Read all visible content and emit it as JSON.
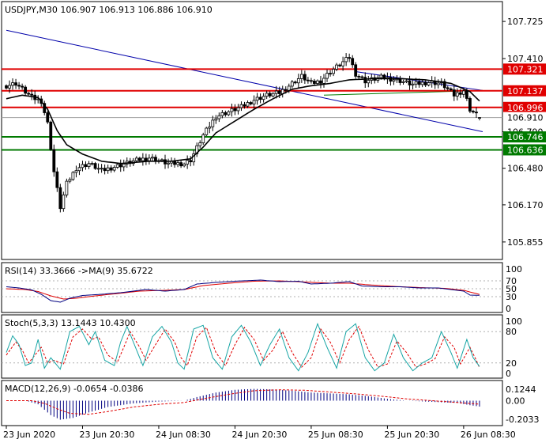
{
  "window": {
    "title": "USDJPY,M30  106.907 106.913 106.886 106.910"
  },
  "colors": {
    "background": "#ffffff",
    "frame": "#000000",
    "candle": "#000000",
    "ma_line": "#000000",
    "support_line": "#007a00",
    "resistance_line": "#e00000",
    "trendline": "#0000aa",
    "current_price_line": "#a0a0a0",
    "rsi_line": "#000080",
    "rsi_ma_line": "#e00000",
    "stoch_main": "#17a5a5",
    "stoch_signal": "#e00000",
    "macd_hist": "#000080",
    "macd_signal": "#e00000",
    "level_grid": "#b0b0b0"
  },
  "chart_data": [
    {
      "type": "candlestick",
      "name": "price",
      "symbol": "USDJPY",
      "timeframe": "M30",
      "header": "USDJPY,M30  106.907 106.913 106.886 106.910",
      "ohlc_current": {
        "open": 106.907,
        "high": 106.913,
        "low": 106.886,
        "close": 106.91
      },
      "ylim": [
        105.72,
        107.88
      ],
      "y_ticks": [
        107.725,
        107.41,
        107.1,
        106.79,
        106.48,
        106.17,
        105.855
      ],
      "y_tick_labels": [
        "107.725",
        "107.410",
        "",
        "106.790",
        "106.480",
        "106.170",
        "105.855"
      ],
      "x_tick_labels": [
        "23 Jun 2020",
        "23 Jun 20:30",
        "24 Jun 08:30",
        "24 Jun 20:30",
        "25 Jun 08:30",
        "25 Jun 20:30",
        "26 Jun 08:30"
      ],
      "x_tick_bars": [
        0,
        24,
        48,
        72,
        96,
        120,
        144
      ],
      "bars": 150,
      "anchors": [
        [
          0,
          107.18
        ],
        [
          3,
          107.2
        ],
        [
          8,
          107.08
        ],
        [
          11,
          107.05
        ],
        [
          13,
          106.86
        ],
        [
          15,
          106.45
        ],
        [
          17,
          106.15
        ],
        [
          19,
          106.35
        ],
        [
          22,
          106.48
        ],
        [
          26,
          106.52
        ],
        [
          30,
          106.46
        ],
        [
          35,
          106.5
        ],
        [
          40,
          106.54
        ],
        [
          45,
          106.57
        ],
        [
          51,
          106.52
        ],
        [
          56,
          106.52
        ],
        [
          58,
          106.55
        ],
        [
          62,
          106.76
        ],
        [
          66,
          106.92
        ],
        [
          70,
          106.96
        ],
        [
          74,
          107.0
        ],
        [
          78,
          107.06
        ],
        [
          82,
          107.1
        ],
        [
          86,
          107.12
        ],
        [
          90,
          107.2
        ],
        [
          93,
          107.26
        ],
        [
          96,
          107.2
        ],
        [
          99,
          107.22
        ],
        [
          102,
          107.3
        ],
        [
          105,
          107.36
        ],
        [
          108,
          107.42
        ],
        [
          110,
          107.28
        ],
        [
          113,
          107.22
        ],
        [
          118,
          107.25
        ],
        [
          123,
          107.23
        ],
        [
          128,
          107.19
        ],
        [
          133,
          107.21
        ],
        [
          137,
          107.2
        ],
        [
          141,
          107.1
        ],
        [
          144,
          107.14
        ],
        [
          146,
          106.98
        ],
        [
          149,
          106.91
        ]
      ],
      "moving_average": {
        "anchors": [
          [
            0,
            107.07
          ],
          [
            5,
            107.1
          ],
          [
            10,
            107.08
          ],
          [
            13,
            106.98
          ],
          [
            16,
            106.8
          ],
          [
            19,
            106.68
          ],
          [
            24,
            106.6
          ],
          [
            30,
            106.54
          ],
          [
            36,
            106.52
          ],
          [
            45,
            106.54
          ],
          [
            52,
            106.54
          ],
          [
            58,
            106.56
          ],
          [
            62,
            106.66
          ],
          [
            66,
            106.78
          ],
          [
            72,
            106.88
          ],
          [
            78,
            106.98
          ],
          [
            84,
            107.07
          ],
          [
            90,
            107.15
          ],
          [
            96,
            107.18
          ],
          [
            102,
            107.2
          ],
          [
            108,
            107.23
          ],
          [
            116,
            107.24
          ],
          [
            124,
            107.24
          ],
          [
            132,
            107.23
          ],
          [
            140,
            107.2
          ],
          [
            146,
            107.13
          ],
          [
            149,
            107.05
          ]
        ]
      },
      "horizontal_levels": [
        {
          "value": 107.321,
          "label": "107.321",
          "kind": "resistance",
          "color": "#e00000"
        },
        {
          "value": 107.137,
          "label": "107.137",
          "kind": "resistance",
          "color": "#e00000"
        },
        {
          "value": 106.996,
          "label": "106.996",
          "kind": "resistance",
          "color": "#e00000"
        },
        {
          "value": 106.746,
          "label": "106.746",
          "kind": "support",
          "color": "#007a00"
        },
        {
          "value": 106.636,
          "label": "106.636",
          "kind": "support",
          "color": "#007a00"
        }
      ],
      "current_price": {
        "value": 106.91,
        "label": "106.910"
      },
      "trendlines": [
        {
          "from": [
            0,
            107.65
          ],
          "to": [
            150,
            106.79
          ],
          "color": "#0000aa"
        },
        {
          "from": [
            110,
            107.3
          ],
          "to": [
            150,
            107.14
          ],
          "color": "#0000aa"
        },
        {
          "from": [
            100,
            107.1
          ],
          "to": [
            150,
            107.14
          ],
          "color": "#007a00"
        }
      ]
    },
    {
      "type": "line",
      "name": "rsi",
      "header": "RSI(14) 33.3666 ->MA(9) 35.6722",
      "rsi_value": 33.3666,
      "ma_value": 35.6722,
      "ylim": [
        0,
        100
      ],
      "levels": [
        100,
        70,
        50,
        30,
        0
      ],
      "level_labels": [
        "100",
        "70",
        "50",
        "30",
        "0"
      ],
      "rsi_anchors": [
        [
          0,
          55
        ],
        [
          4,
          52
        ],
        [
          8,
          47
        ],
        [
          11,
          36
        ],
        [
          14,
          20
        ],
        [
          17,
          16
        ],
        [
          20,
          26
        ],
        [
          24,
          33
        ],
        [
          30,
          36
        ],
        [
          36,
          40
        ],
        [
          44,
          48
        ],
        [
          50,
          44
        ],
        [
          56,
          48
        ],
        [
          60,
          62
        ],
        [
          66,
          66
        ],
        [
          72,
          69
        ],
        [
          80,
          72
        ],
        [
          86,
          68
        ],
        [
          92,
          69
        ],
        [
          96,
          62
        ],
        [
          102,
          64
        ],
        [
          108,
          68
        ],
        [
          112,
          57
        ],
        [
          118,
          55
        ],
        [
          124,
          55
        ],
        [
          130,
          52
        ],
        [
          136,
          52
        ],
        [
          140,
          48
        ],
        [
          144,
          44
        ],
        [
          146,
          34
        ],
        [
          149,
          33.37
        ]
      ],
      "ma_anchors": [
        [
          0,
          50
        ],
        [
          6,
          48
        ],
        [
          10,
          43
        ],
        [
          14,
          32
        ],
        [
          18,
          24
        ],
        [
          22,
          26
        ],
        [
          28,
          32
        ],
        [
          34,
          37
        ],
        [
          42,
          44
        ],
        [
          50,
          46
        ],
        [
          56,
          48
        ],
        [
          62,
          58
        ],
        [
          70,
          64
        ],
        [
          78,
          69
        ],
        [
          86,
          70
        ],
        [
          94,
          67
        ],
        [
          102,
          64
        ],
        [
          108,
          64
        ],
        [
          114,
          60
        ],
        [
          122,
          56
        ],
        [
          130,
          53
        ],
        [
          138,
          51
        ],
        [
          144,
          46
        ],
        [
          149,
          35.67
        ]
      ]
    },
    {
      "type": "line",
      "name": "stochastic",
      "header": "Stoch(5,3,3) 13.1443 10.4300",
      "main_value": 13.1443,
      "signal_value": 10.43,
      "ylim": [
        0,
        100
      ],
      "levels": [
        100,
        80,
        20,
        0
      ],
      "level_labels": [
        "100",
        "80",
        "20",
        "0"
      ],
      "main_anchors": [
        [
          0,
          40
        ],
        [
          2,
          72
        ],
        [
          4,
          55
        ],
        [
          6,
          15
        ],
        [
          8,
          20
        ],
        [
          10,
          65
        ],
        [
          12,
          10
        ],
        [
          14,
          30
        ],
        [
          17,
          8
        ],
        [
          20,
          80
        ],
        [
          23,
          90
        ],
        [
          26,
          55
        ],
        [
          28,
          80
        ],
        [
          31,
          25
        ],
        [
          34,
          15
        ],
        [
          36,
          60
        ],
        [
          38,
          90
        ],
        [
          41,
          45
        ],
        [
          43,
          15
        ],
        [
          46,
          70
        ],
        [
          49,
          90
        ],
        [
          52,
          60
        ],
        [
          54,
          20
        ],
        [
          56,
          8
        ],
        [
          59,
          85
        ],
        [
          62,
          92
        ],
        [
          65,
          30
        ],
        [
          68,
          8
        ],
        [
          71,
          70
        ],
        [
          74,
          92
        ],
        [
          77,
          60
        ],
        [
          80,
          15
        ],
        [
          83,
          55
        ],
        [
          86,
          85
        ],
        [
          89,
          30
        ],
        [
          92,
          5
        ],
        [
          95,
          40
        ],
        [
          98,
          95
        ],
        [
          101,
          50
        ],
        [
          104,
          10
        ],
        [
          107,
          80
        ],
        [
          110,
          95
        ],
        [
          113,
          30
        ],
        [
          116,
          5
        ],
        [
          119,
          20
        ],
        [
          122,
          75
        ],
        [
          125,
          30
        ],
        [
          128,
          5
        ],
        [
          131,
          20
        ],
        [
          134,
          30
        ],
        [
          137,
          80
        ],
        [
          140,
          40
        ],
        [
          142,
          10
        ],
        [
          145,
          65
        ],
        [
          147,
          30
        ],
        [
          149,
          13.14
        ]
      ],
      "signal_anchors": [
        [
          0,
          35
        ],
        [
          3,
          60
        ],
        [
          5,
          45
        ],
        [
          7,
          20
        ],
        [
          9,
          35
        ],
        [
          11,
          50
        ],
        [
          13,
          20
        ],
        [
          15,
          25
        ],
        [
          18,
          18
        ],
        [
          21,
          70
        ],
        [
          24,
          85
        ],
        [
          27,
          65
        ],
        [
          29,
          70
        ],
        [
          32,
          35
        ],
        [
          35,
          22
        ],
        [
          37,
          50
        ],
        [
          39,
          80
        ],
        [
          42,
          50
        ],
        [
          44,
          25
        ],
        [
          47,
          55
        ],
        [
          50,
          85
        ],
        [
          53,
          60
        ],
        [
          55,
          30
        ],
        [
          57,
          15
        ],
        [
          60,
          70
        ],
        [
          63,
          88
        ],
        [
          66,
          40
        ],
        [
          69,
          15
        ],
        [
          72,
          55
        ],
        [
          75,
          88
        ],
        [
          78,
          65
        ],
        [
          81,
          25
        ],
        [
          84,
          45
        ],
        [
          87,
          80
        ],
        [
          90,
          40
        ],
        [
          93,
          12
        ],
        [
          96,
          30
        ],
        [
          99,
          85
        ],
        [
          102,
          60
        ],
        [
          105,
          20
        ],
        [
          108,
          65
        ],
        [
          111,
          90
        ],
        [
          114,
          45
        ],
        [
          117,
          12
        ],
        [
          120,
          18
        ],
        [
          123,
          62
        ],
        [
          126,
          40
        ],
        [
          129,
          12
        ],
        [
          132,
          18
        ],
        [
          135,
          28
        ],
        [
          138,
          70
        ],
        [
          141,
          50
        ],
        [
          143,
          18
        ],
        [
          146,
          50
        ],
        [
          148,
          25
        ],
        [
          149,
          10.43
        ]
      ]
    },
    {
      "type": "bar",
      "name": "macd",
      "header": "MACD(12,26,9) -0.0654 -0.0386",
      "macd_value": -0.0654,
      "signal_value": -0.0386,
      "ylim": [
        -0.24,
        0.17
      ],
      "level_labels": [
        "0.1244",
        "0.00",
        "-0.2033"
      ],
      "level_values": [
        0.1244,
        0.0,
        -0.2033
      ],
      "hist_anchors": [
        [
          0,
          0.0
        ],
        [
          6,
          0.0
        ],
        [
          10,
          -0.04
        ],
        [
          14,
          -0.16
        ],
        [
          17,
          -0.21
        ],
        [
          21,
          -0.19
        ],
        [
          26,
          -0.13
        ],
        [
          32,
          -0.07
        ],
        [
          40,
          -0.03
        ],
        [
          48,
          -0.01
        ],
        [
          56,
          0.0
        ],
        [
          60,
          0.04
        ],
        [
          66,
          0.09
        ],
        [
          72,
          0.12
        ],
        [
          78,
          0.13
        ],
        [
          84,
          0.125
        ],
        [
          90,
          0.11
        ],
        [
          96,
          0.09
        ],
        [
          102,
          0.08
        ],
        [
          108,
          0.07
        ],
        [
          114,
          0.05
        ],
        [
          120,
          0.02
        ],
        [
          126,
          0.0
        ],
        [
          132,
          -0.01
        ],
        [
          138,
          -0.02
        ],
        [
          142,
          -0.025
        ],
        [
          146,
          -0.05
        ],
        [
          149,
          -0.065
        ]
      ],
      "signal_anchors": [
        [
          0,
          0.0
        ],
        [
          8,
          0.0
        ],
        [
          12,
          -0.03
        ],
        [
          16,
          -0.09
        ],
        [
          20,
          -0.14
        ],
        [
          26,
          -0.15
        ],
        [
          32,
          -0.12
        ],
        [
          40,
          -0.07
        ],
        [
          48,
          -0.04
        ],
        [
          56,
          -0.02
        ],
        [
          62,
          0.02
        ],
        [
          70,
          0.07
        ],
        [
          78,
          0.11
        ],
        [
          86,
          0.12
        ],
        [
          94,
          0.115
        ],
        [
          102,
          0.095
        ],
        [
          110,
          0.075
        ],
        [
          118,
          0.05
        ],
        [
          126,
          0.02
        ],
        [
          134,
          0.0
        ],
        [
          142,
          -0.02
        ],
        [
          149,
          -0.0386
        ]
      ]
    }
  ]
}
